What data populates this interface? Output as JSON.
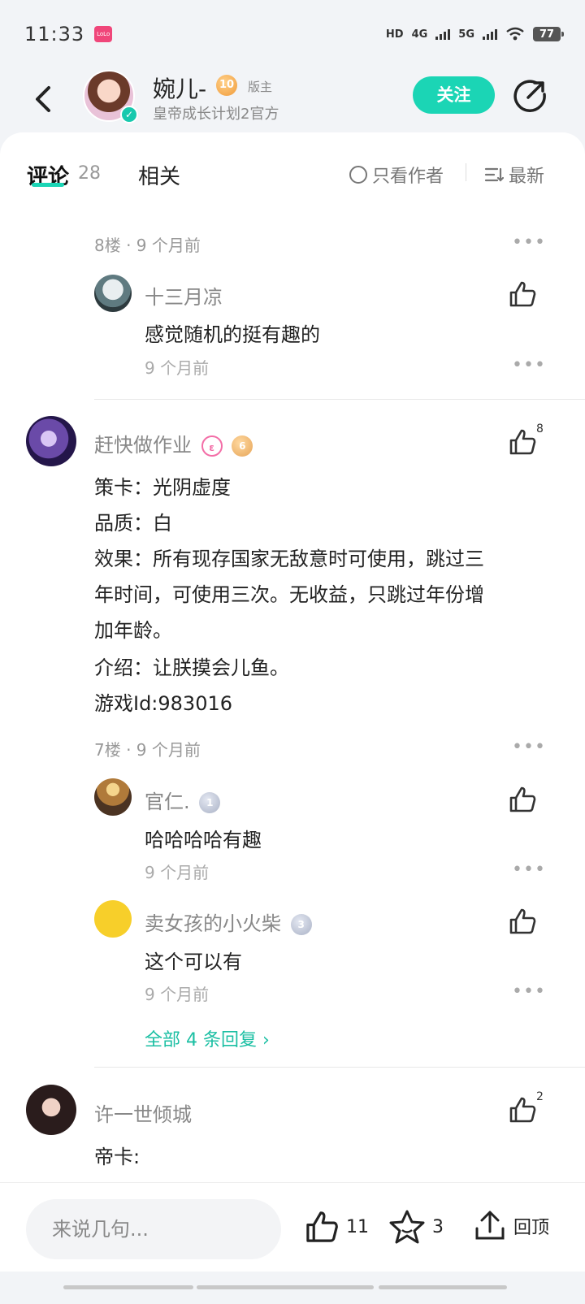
{
  "status_bar": {
    "time": "11:33",
    "app_badge": "LoLo",
    "hd": "HD",
    "net4g": "4G",
    "net5g": "5G",
    "battery": "77"
  },
  "header": {
    "author_name": "婉儿-",
    "author_level": "10",
    "author_role": "版主",
    "author_desc": "皇帝成长计划2官方",
    "follow_label": "关注"
  },
  "tabs": {
    "comments_label": "评论",
    "comments_count": "28",
    "related_label": "相关",
    "author_only_label": "只看作者",
    "sort_label": "最新"
  },
  "floor8": {
    "meta": "8楼 · 9 个月前",
    "reply": {
      "name": "十三月凉",
      "text": "感觉随机的挺有趣的",
      "time": "9 个月前"
    }
  },
  "floor7": {
    "author": "赶快做作业",
    "badge_level": "6",
    "likes": "8",
    "lines": [
      "策卡：光阴虚度",
      "品质：白",
      "效果：所有现存国家无敌意时可使用，跳过三",
      "年时间，可使用三次。无收益，只跳过年份增",
      "加年龄。",
      "介绍：让朕摸会儿鱼。",
      "游戏Id:983016"
    ],
    "meta": "7楼 · 9 个月前",
    "replies": [
      {
        "name": "官仁.",
        "level": "1",
        "text": "哈哈哈哈有趣",
        "time": "9 个月前"
      },
      {
        "name": "卖女孩的小火柴",
        "level": "3",
        "text": "这个可以有",
        "time": "9 个月前"
      }
    ],
    "all_replies": "全部 4 条回复 ›"
  },
  "floor6": {
    "author": "许一世倾城",
    "likes": "2",
    "first_line": "帝卡:"
  },
  "bottom_bar": {
    "input_placeholder": "来说几句...",
    "like_count": "11",
    "fav_count": "3",
    "top_label": "回顶"
  },
  "colors": {
    "accent": "#1bd5b5",
    "link": "#1bbfa3"
  }
}
